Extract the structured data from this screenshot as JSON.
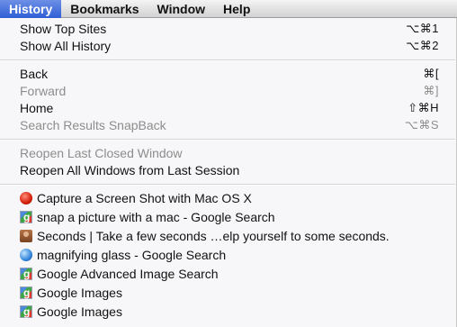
{
  "menubar": {
    "items": [
      "History",
      "Bookmarks",
      "Window",
      "Help"
    ]
  },
  "menu": {
    "show_top_sites": {
      "label": "Show Top Sites",
      "shortcut": "⌥⌘1"
    },
    "show_all_history": {
      "label": "Show All History",
      "shortcut": "⌥⌘2"
    },
    "back": {
      "label": "Back",
      "shortcut": "⌘["
    },
    "forward": {
      "label": "Forward",
      "shortcut": "⌘]"
    },
    "home": {
      "label": "Home",
      "shortcut": "⇧⌘H"
    },
    "search_snapback": {
      "label": "Search Results SnapBack",
      "shortcut": "⌥⌘S"
    },
    "reopen_last": {
      "label": "Reopen Last Closed Window"
    },
    "reopen_all": {
      "label": "Reopen All Windows from Last Session"
    },
    "history_items": [
      {
        "label": "Capture a Screen Shot with Mac OS X",
        "icon": "red-circle-icon"
      },
      {
        "label": "snap a picture with a mac - Google Search",
        "icon": "google-icon"
      },
      {
        "label": "Seconds | Take a few seconds …elp yourself to some seconds.",
        "icon": "person-icon"
      },
      {
        "label": "magnifying glass - Google Search",
        "icon": "globe-icon"
      },
      {
        "label": "Google Advanced Image Search",
        "icon": "google-icon"
      },
      {
        "label": "Google Images",
        "icon": "google-icon"
      },
      {
        "label": "Google Images",
        "icon": "google-icon"
      }
    ]
  },
  "colors": {
    "highlight": "#2f5fd6",
    "disabled_text": "#8d8d8d"
  }
}
